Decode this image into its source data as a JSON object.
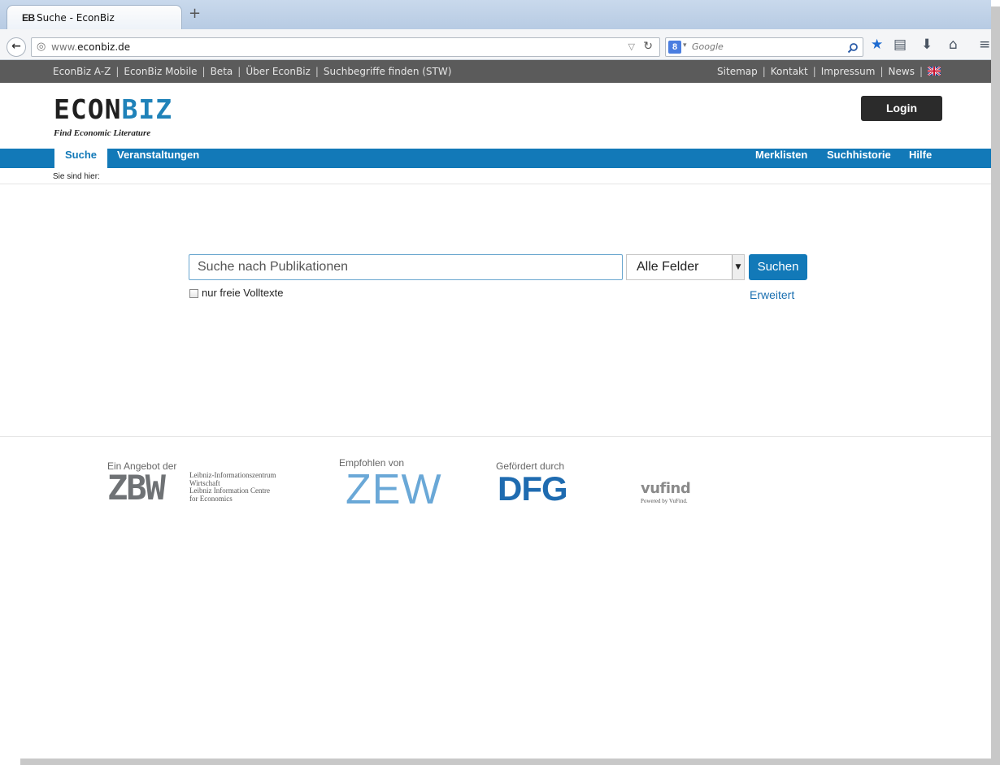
{
  "browser": {
    "tab_favicon": "EB",
    "tab_title": "Suche - EconBiz",
    "new_tab_label": "+",
    "url_prefix": "www.",
    "url_domain": "econbiz.de",
    "search_engine_badge": "8",
    "search_placeholder": "Google",
    "icons": [
      "back-arrow-icon",
      "globe-icon",
      "reload-icon",
      "search-magnifier-icon",
      "bookmark-star-icon",
      "reading-list-icon",
      "download-icon",
      "home-icon",
      "menu-icon"
    ]
  },
  "topbar": {
    "left_links": [
      "EconBiz A-Z",
      "EconBiz Mobile",
      "Beta",
      "Über EconBiz",
      "Suchbegriffe finden (STW)"
    ],
    "right_links": [
      "Sitemap",
      "Kontakt",
      "Impressum",
      "News"
    ],
    "separator": "|"
  },
  "header": {
    "logo_part1": "ECON",
    "logo_part2": "BIZ",
    "tagline": "Find Economic Literature",
    "login_label": "Login"
  },
  "mainnav": {
    "left": [
      "Suche",
      "Veranstaltungen"
    ],
    "right": [
      "Merklisten",
      "Suchhistorie",
      "Hilfe"
    ],
    "breadcrumb": "Sie sind hier:"
  },
  "search": {
    "placeholder": "Suche nach Publikationen",
    "field_select_value": "Alle Felder",
    "submit_label": "Suchen",
    "checkbox_label": "nur freie Volltexte",
    "advanced_link": "Erweitert"
  },
  "footer": {
    "zbw_caption": "Ein Angebot der",
    "zbw_logo": "ZBW",
    "zbw_text": [
      "Leibniz-Informationszentrum",
      "Wirtschaft",
      "Leibniz Information Centre",
      "for Economics"
    ],
    "zew_caption": "Empfohlen von",
    "zew_logo": "ZEW",
    "dfg_caption": "Gefördert durch",
    "dfg_logo": "DFG",
    "vufind_logo": "vufind",
    "vufind_sub": "Powered by VuFind."
  },
  "colors": {
    "accent": "#1279b8",
    "topbar_bg": "#5b5b5b",
    "login_bg": "#2b2b2b"
  }
}
